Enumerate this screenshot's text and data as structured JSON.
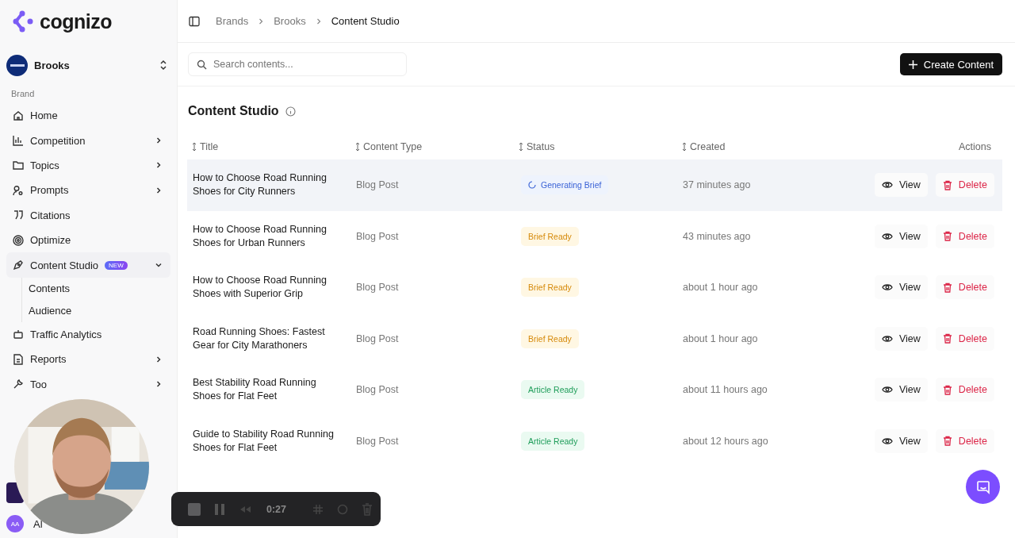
{
  "sidebar": {
    "logo": "cognizo",
    "brand": {
      "name": "Brooks"
    },
    "section": "Brand",
    "items": [
      {
        "label": "Home",
        "kind": "link"
      },
      {
        "label": "Competition",
        "kind": "group",
        "expanded": false
      },
      {
        "label": "Topics",
        "kind": "group",
        "expanded": false
      },
      {
        "label": "Prompts",
        "kind": "group",
        "expanded": false
      },
      {
        "label": "Citations",
        "kind": "link"
      },
      {
        "label": "Optimize",
        "kind": "link"
      },
      {
        "label": "Content Studio",
        "badge": "NEW",
        "kind": "group",
        "expanded": true,
        "children": [
          {
            "label": "Contents"
          },
          {
            "label": "Audience"
          }
        ]
      },
      {
        "label": "Traffic Analytics",
        "kind": "link"
      },
      {
        "label": "Reports",
        "kind": "group",
        "expanded": false
      },
      {
        "label": "Too",
        "kind": "group",
        "expanded": false
      }
    ],
    "user": {
      "initials": "AA",
      "name": "Al"
    }
  },
  "breadcrumb": [
    "Brands",
    "Brooks",
    "Content Studio"
  ],
  "search": {
    "placeholder": "Search contents..."
  },
  "create_button": "Create Content",
  "page_title": "Content Studio",
  "table": {
    "columns": [
      {
        "label": "Title",
        "sortable": true
      },
      {
        "label": "Content Type",
        "sortable": true
      },
      {
        "label": "Status",
        "sortable": true
      },
      {
        "label": "Created",
        "sortable": true
      },
      {
        "label": "Actions",
        "sortable": false
      }
    ],
    "rows": [
      {
        "title": "How to Choose Road Running Shoes for City Runners",
        "type": "Blog Post",
        "status": {
          "label": "Generating Brief",
          "kind": "generating"
        },
        "created": "37 minutes ago",
        "view": "View",
        "delete": "Delete",
        "highlighted": true
      },
      {
        "title": "How to Choose Road Running Shoes for Urban Runners",
        "type": "Blog Post",
        "status": {
          "label": "Brief Ready",
          "kind": "brief"
        },
        "created": "43 minutes ago",
        "view": "View",
        "delete": "Delete",
        "highlighted": false
      },
      {
        "title": "How to Choose Road Running Shoes with Superior Grip",
        "type": "Blog Post",
        "status": {
          "label": "Brief Ready",
          "kind": "brief"
        },
        "created": "about 1 hour ago",
        "view": "View",
        "delete": "Delete",
        "highlighted": false
      },
      {
        "title": "Road Running Shoes: Fastest Gear for City Marathoners",
        "type": "Blog Post",
        "status": {
          "label": "Brief Ready",
          "kind": "brief"
        },
        "created": "about 1 hour ago",
        "view": "View",
        "delete": "Delete",
        "highlighted": false
      },
      {
        "title": "Best Stability Road Running Shoes for Flat Feet",
        "type": "Blog Post",
        "status": {
          "label": "Article Ready",
          "kind": "article"
        },
        "created": "about 11 hours ago",
        "view": "View",
        "delete": "Delete",
        "highlighted": false
      },
      {
        "title": "Guide to Stability Road Running Shoes for Flat Feet",
        "type": "Blog Post",
        "status": {
          "label": "Article Ready",
          "kind": "article"
        },
        "created": "about 12 hours ago",
        "view": "View",
        "delete": "Delete",
        "highlighted": false
      }
    ]
  },
  "recorder": {
    "time": "0:27"
  }
}
